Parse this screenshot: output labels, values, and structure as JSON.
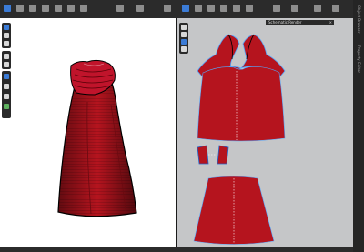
{
  "toolbar": {
    "icons": [
      "select-icon",
      "move-icon",
      "sewing-icon",
      "pin-icon",
      "brush-icon",
      "tape-icon",
      "fold-icon",
      "render-icon",
      "grid-icon",
      "camera-icon",
      "light-icon",
      "pattern-icon",
      "point-icon",
      "segment-icon",
      "seam-icon",
      "notch-icon",
      "dart-icon",
      "trace-icon"
    ]
  },
  "viewport2d": {
    "schematic_label": "Schematic Render",
    "close_glyph": "×"
  },
  "right_rail": {
    "labels": [
      "Object Browser",
      "Property Editor"
    ]
  },
  "colors": {
    "garment": "#b5141e",
    "garment_dark": "#7a0c14",
    "collar": "#c0142b",
    "accent": "#3b7bd6",
    "viewport3d_bg": "#ffffff",
    "viewport2d_bg": "#c5c6c8"
  }
}
